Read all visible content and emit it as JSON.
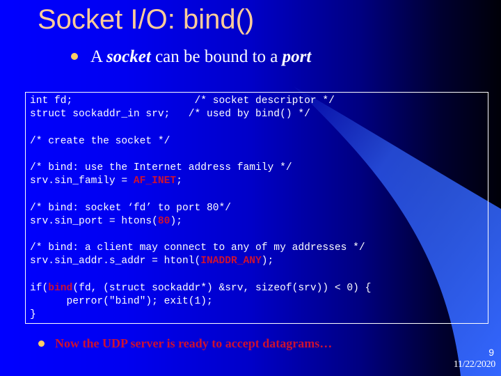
{
  "slide": {
    "title": "Socket I/O: bind()",
    "bullet1": {
      "prefix": "A ",
      "em1": "socket",
      "middle": " can be bound to a ",
      "em2": "port"
    },
    "code_lines": [
      {
        "parts": [
          {
            "t": "int fd;                    /* socket descriptor */"
          }
        ]
      },
      {
        "parts": [
          {
            "t": "struct sockaddr_in srv;   /* used by bind() */"
          }
        ]
      },
      {
        "parts": [
          {
            "t": ""
          }
        ]
      },
      {
        "parts": [
          {
            "t": "/* create the socket */"
          }
        ]
      },
      {
        "parts": [
          {
            "t": ""
          }
        ]
      },
      {
        "parts": [
          {
            "t": "/* bind: use the Internet address family */"
          }
        ]
      },
      {
        "parts": [
          {
            "t": "srv.sin_family = "
          },
          {
            "t": "AF_INET",
            "hl": true
          },
          {
            "t": ";"
          }
        ]
      },
      {
        "parts": [
          {
            "t": ""
          }
        ]
      },
      {
        "parts": [
          {
            "t": "/* bind: socket ‘fd’ to port 80*/"
          }
        ]
      },
      {
        "parts": [
          {
            "t": "srv.sin_port = htons("
          },
          {
            "t": "80",
            "hl": true
          },
          {
            "t": ");"
          }
        ]
      },
      {
        "parts": [
          {
            "t": ""
          }
        ]
      },
      {
        "parts": [
          {
            "t": "/* bind: a client may connect to any of my addresses */"
          }
        ]
      },
      {
        "parts": [
          {
            "t": "srv.sin_addr.s_addr = htonl("
          },
          {
            "t": "INADDR_ANY",
            "hl": true
          },
          {
            "t": ");"
          }
        ]
      },
      {
        "parts": [
          {
            "t": ""
          }
        ]
      },
      {
        "parts": [
          {
            "t": "if("
          },
          {
            "t": "bind",
            "hl": true
          },
          {
            "t": "(fd, (struct sockaddr*) &srv, sizeof(srv)) < 0) {"
          }
        ]
      },
      {
        "parts": [
          {
            "t": "      perror(\"bind\"); exit(1);"
          }
        ]
      },
      {
        "parts": [
          {
            "t": "}"
          }
        ]
      }
    ],
    "bullet2": "Now the UDP server  is ready to accept datagrams…",
    "slide_number": "9",
    "date": "11/22/2020"
  },
  "colors": {
    "title": "#ffcc99",
    "bullet": "#ffcc66",
    "highlight": "#cc1133",
    "beam": "#3366ff",
    "text": "#ffffff"
  },
  "icons": {
    "bullet": "bullet-dot-icon"
  }
}
